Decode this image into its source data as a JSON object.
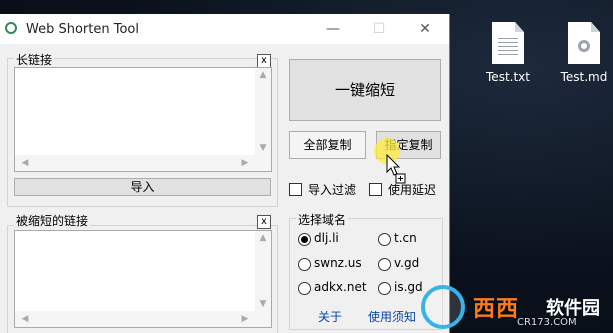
{
  "window": {
    "title": "Web Shorten Tool",
    "controls": {
      "minimize": "—",
      "maximize": "☐",
      "close": "✕"
    }
  },
  "long_link": {
    "label": "长链接",
    "value": "",
    "clear": "x",
    "import_label": "导入"
  },
  "shortened": {
    "label": "被缩短的链接",
    "value": "",
    "clear": "x"
  },
  "actions": {
    "shorten_label": "一键缩短",
    "copy_all_label": "全部复制",
    "copy_selected_label": "指定复制"
  },
  "options": {
    "import_filter": {
      "label": "导入过滤",
      "checked": false
    },
    "use_delay": {
      "label": "使用延迟",
      "checked": false
    }
  },
  "domain_group": {
    "title": "选择域名",
    "options": [
      {
        "label": "dlj.li",
        "selected": true
      },
      {
        "label": "t.cn",
        "selected": false
      },
      {
        "label": "swnz.us",
        "selected": false
      },
      {
        "label": "v.gd",
        "selected": false
      },
      {
        "label": "adkx.net",
        "selected": false
      },
      {
        "label": "is.gd",
        "selected": false
      }
    ]
  },
  "links": {
    "about": "关于",
    "instructions": "使用须知"
  },
  "desktop_icons": [
    {
      "label": "Test.txt",
      "icon": "text-file-icon"
    },
    {
      "label": "Test.md",
      "icon": "settings-file-icon"
    }
  ],
  "watermark": {
    "brand": "西西",
    "suffix": "软件园",
    "site": "CR173.COM"
  },
  "colors": {
    "link": "#0645ad",
    "app_icon": "#2e8b57",
    "watermark_orange": "#ff7a1a",
    "watermark_blue": "#38b3e8"
  }
}
